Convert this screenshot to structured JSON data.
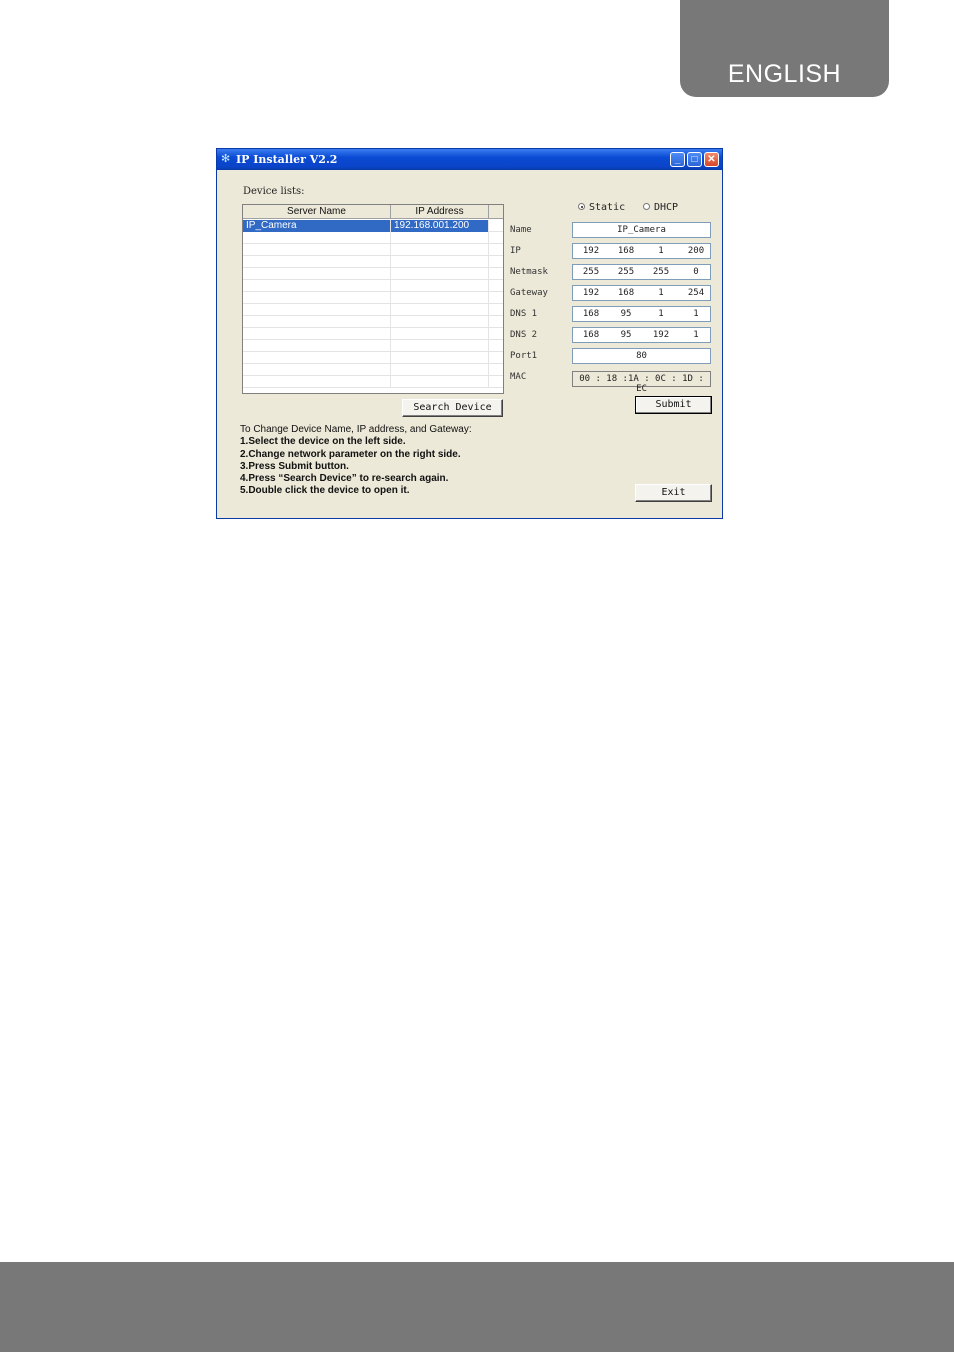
{
  "page": {
    "language_tab": "ENGLISH"
  },
  "window": {
    "title": "IP Installer V2.2",
    "controls": {
      "minimize": "_",
      "maximize": "□",
      "close": "✕"
    }
  },
  "device_list": {
    "label": "Device lists:",
    "columns": [
      "Server Name",
      "IP Address"
    ],
    "rows": [
      {
        "server_name": "IP_Camera",
        "ip_address": "192.168.001.200",
        "selected": true
      }
    ]
  },
  "search_button": "Search Device",
  "instructions": {
    "heading": "To Change Device Name, IP address, and Gateway:",
    "steps": [
      "1.Select the device on the left side.",
      "2.Change network parameter on the right side.",
      "3.Press Submit button.",
      "4.Press “Search Device” to re-search again.",
      "5.Double click the device to open it."
    ]
  },
  "mode": {
    "static_label": "Static",
    "dhcp_label": "DHCP",
    "selected": "Static"
  },
  "fields": {
    "name": {
      "label": "Name",
      "value": "IP_Camera"
    },
    "ip": {
      "label": "IP",
      "octets": [
        "192",
        "168",
        "1",
        "200"
      ]
    },
    "netmask": {
      "label": "Netmask",
      "octets": [
        "255",
        "255",
        "255",
        "0"
      ]
    },
    "gateway": {
      "label": "Gateway",
      "octets": [
        "192",
        "168",
        "1",
        "254"
      ]
    },
    "dns1": {
      "label": "DNS 1",
      "octets": [
        "168",
        "95",
        "1",
        "1"
      ]
    },
    "dns2": {
      "label": "DNS 2",
      "octets": [
        "168",
        "95",
        "192",
        "1"
      ]
    },
    "port": {
      "label": "Port1",
      "value": "80"
    },
    "mac": {
      "label": "MAC",
      "value": "00 : 18 :1A : 0C : 1D : EC"
    }
  },
  "submit_button": "Submit",
  "exit_button": "Exit"
}
